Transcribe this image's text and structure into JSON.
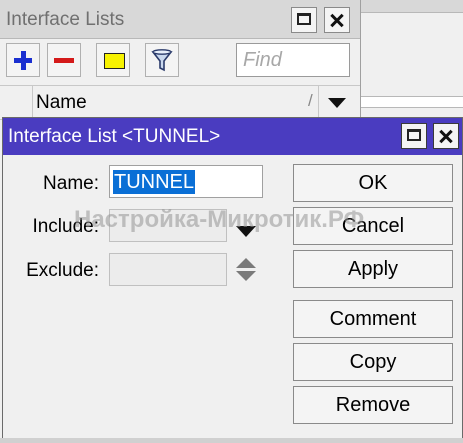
{
  "bg_window": {
    "title": "Interface Lists",
    "toolbar": {
      "add_icon": "plus-icon",
      "remove_icon": "minus-icon",
      "comment_icon": "note-icon",
      "filter_icon": "filter-icon"
    },
    "find_placeholder": "Find",
    "column_header": "Name",
    "header_slash": "/"
  },
  "dialog": {
    "title": "Interface List <TUNNEL>",
    "fields": {
      "name_label": "Name:",
      "name_value": "TUNNEL",
      "include_label": "Include:",
      "exclude_label": "Exclude:"
    },
    "buttons": {
      "ok": "OK",
      "cancel": "Cancel",
      "apply": "Apply",
      "comment": "Comment",
      "copy": "Copy",
      "remove": "Remove"
    }
  },
  "watermark": "Настройка-Микротик.РФ",
  "colors": {
    "dialog_titlebar": "#4a3cc0",
    "selection": "#0a6fd6",
    "add_blue": "#1a2fd0",
    "remove_red": "#d41a1a",
    "note_yellow": "#f7f200"
  }
}
